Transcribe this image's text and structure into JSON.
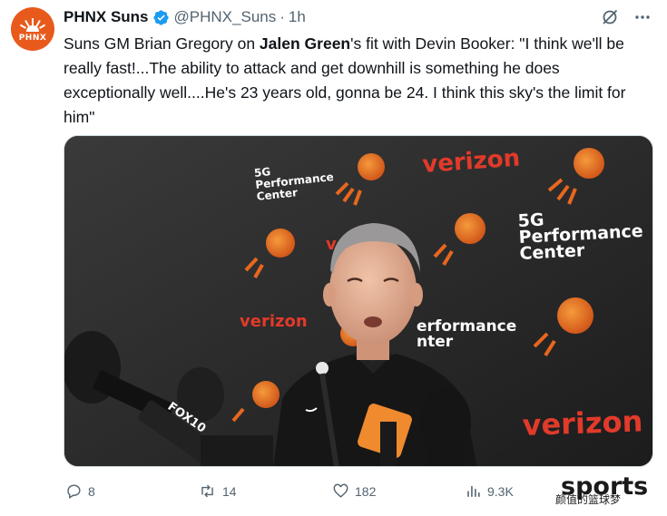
{
  "tweet": {
    "display_name": "PHNX Suns",
    "handle": "@PHNX_Suns",
    "separator": "·",
    "time": "1h",
    "avatar_text": "PHNX",
    "text_before": "Suns GM Brian Gregory on ",
    "text_mention": "Jalen Green",
    "text_after": "'s fit with Devin Booker: \"I think we'll be really fast!...The ability to attack and get downhill is something he does exceptionally well....He's 23 years old, gonna be 24. I think this sky's the limit for him\""
  },
  "media": {
    "backdrop_words": {
      "verizon": "verizon",
      "fiveg": "5G",
      "performance": "Performance",
      "center": "Center"
    },
    "mic_label": "FOX10"
  },
  "actions": {
    "replies": "8",
    "reposts": "14",
    "likes": "182",
    "views": "9.3K"
  },
  "watermark": {
    "big": "sports",
    "small": "颜值的篮球梦"
  },
  "colors": {
    "brand_orange": "#e85a1c",
    "verified_blue": "#1d9bf0",
    "muted_text": "#536471"
  }
}
